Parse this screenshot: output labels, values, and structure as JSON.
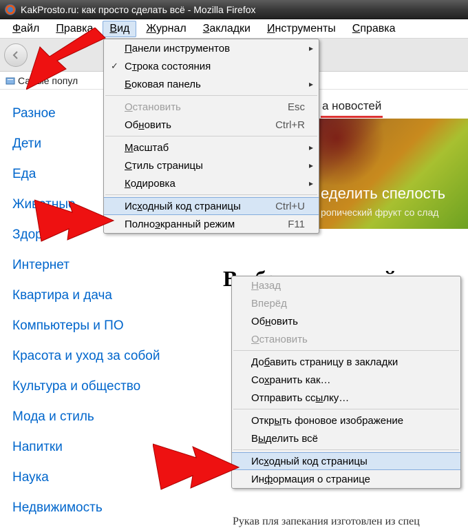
{
  "window": {
    "title": "KakProsto.ru: как просто сделать всё - Mozilla Firefox"
  },
  "menubar": {
    "file": "Файл",
    "edit": "Правка",
    "view": "Вид",
    "history": "Журнал",
    "bookmarks": "Закладки",
    "tools": "Инструменты",
    "help": "Справка"
  },
  "bookmarks_bar": {
    "item1": "Самые попул"
  },
  "view_menu": {
    "toolbars": "Панели инструментов",
    "status_bar": "Строка состояния",
    "sidebar": "Боковая панель",
    "stop": "Остановить",
    "stop_key": "Esc",
    "reload": "Обновить",
    "reload_key": "Ctrl+R",
    "zoom": "Масштаб",
    "page_style": "Стиль страницы",
    "encoding": "Кодировка",
    "source": "Исходный код страницы",
    "source_key": "Ctrl+U",
    "fullscreen": "Полноэкранный режим",
    "fullscreen_key": "F11"
  },
  "context_menu": {
    "back": "Назад",
    "forward": "Вперёд",
    "reload": "Обновить",
    "stop": "Остановить",
    "bookmark": "Добавить страницу в закладки",
    "save_as": "Сохранить как…",
    "send_link": "Отправить ссылку…",
    "open_bg": "Открыть фоновое изображение",
    "select_all": "Выделить всё",
    "source": "Исходный код страницы",
    "page_info": "Информация о странице"
  },
  "sidebar_links": [
    "Разное",
    "Дети",
    "Еда",
    "Животные",
    "Здоро",
    "Интернет",
    "Квартира и дача",
    "Компьютеры и ПО",
    "Красота и уход за собой",
    "Культура и общество",
    "Мода и стиль",
    "Напитки",
    "Наука",
    "Недвижимость"
  ],
  "page_content": {
    "news_tab": "а новостей",
    "banner_title": "еделить спелость",
    "banner_sub": "ропический фрукт со слад",
    "heading": "Выбор читателей",
    "bottom": "Рукав пля запекания изготовлен из спец"
  }
}
